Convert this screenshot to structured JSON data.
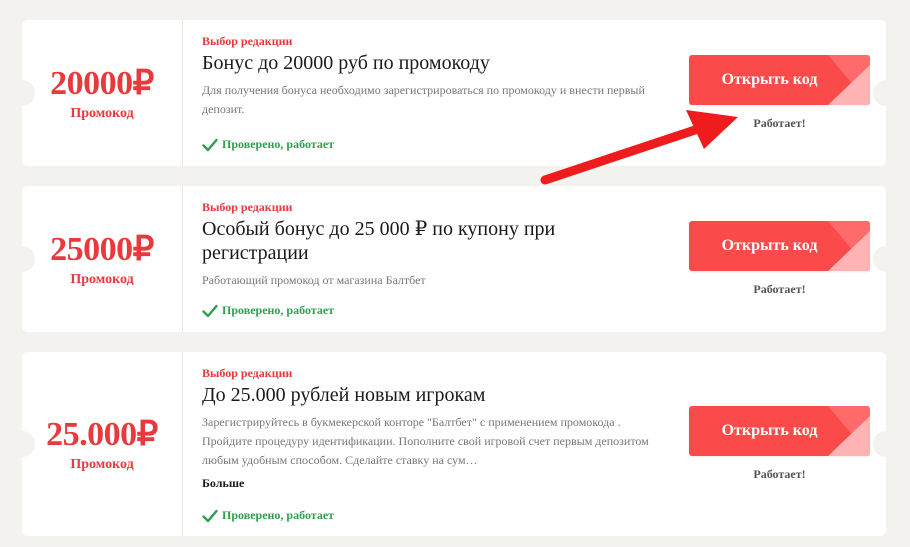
{
  "cards": [
    {
      "amount": "20000₽",
      "amount_label": "Промокод",
      "badge": "Выбор редакции",
      "title": "Бонус до 20000 руб по промокоду",
      "description": "Для получения бонуса необходимо зарегистрироваться по промокоду и внести первый депозит.",
      "verified": "Проверено, работает",
      "button": "Открыть код",
      "status": "Работает!"
    },
    {
      "amount": "25000₽",
      "amount_label": "Промокод",
      "badge": "Выбор редакции",
      "title": "Особый бонус до 25 000 ₽ по купону при регистрации",
      "description": "Работающий промокод от магазина Балтбет",
      "verified": "Проверено, работает",
      "button": "Открыть код",
      "status": "Работает!"
    },
    {
      "amount": "25.000₽",
      "amount_label": "Промокод",
      "badge": "Выбор редакции",
      "title": "До 25.000 рублей новым игрокам",
      "description": "Зарегистрируйтесь в букмекерской конторе \"Балтбет\" с применением промокода . Пройдите процедуру идентификации. Пополните свой игровой счет первым депозитом любым удобным способом. Сделайте ставку на сум…",
      "more": "Больше",
      "verified": "Проверено, работает",
      "button": "Открыть код",
      "status": "Работает!"
    }
  ],
  "colors": {
    "accent": "#fb4a4a",
    "amount": "#e8393c",
    "verified": "#2e9e4f",
    "arrow": "#ee1c1c"
  }
}
